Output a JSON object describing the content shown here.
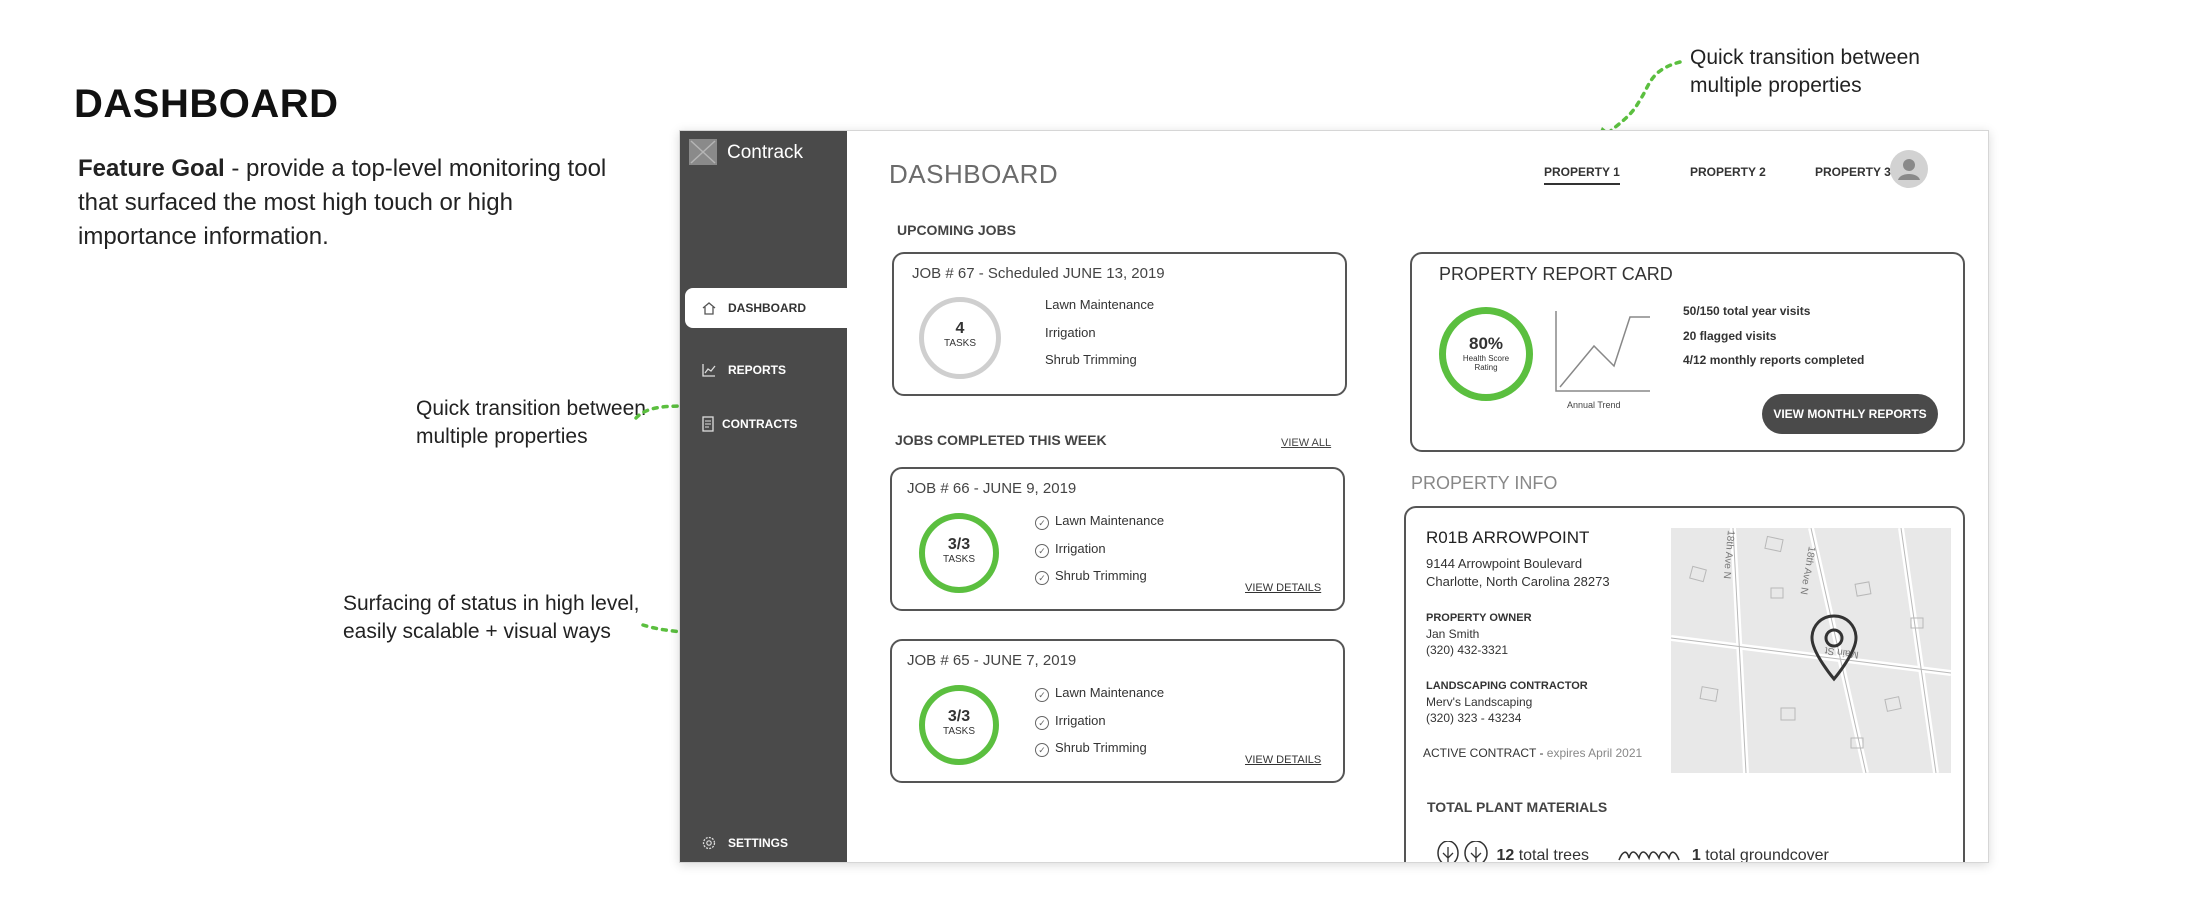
{
  "presentation": {
    "heading": "DASHBOARD",
    "feature_goal_label": "Feature Goal",
    "feature_goal_text": " - provide a top-level monitoring tool that surfaced the most high touch or high importance information.",
    "annotations": {
      "top_right": "Quick transition between multiple properties",
      "left_middle": "Quick transition between multiple properties",
      "left_lower": "Surfacing of status in high level, easily scalable + visual ways"
    },
    "accent_color": "#5bbf3f"
  },
  "app": {
    "brand": "Contrack",
    "sidebar": {
      "items": [
        {
          "label": "DASHBOARD",
          "icon": "home-icon",
          "active": true
        },
        {
          "label": "REPORTS",
          "icon": "chart-icon",
          "active": false
        },
        {
          "label": "CONTRACTS",
          "icon": "document-icon",
          "active": false
        }
      ],
      "settings_label": "SETTINGS"
    },
    "header": {
      "title": "DASHBOARD",
      "tabs": [
        "PROPERTY 1",
        "PROPERTY 2",
        "PROPERTY 3"
      ],
      "active_tab": "PROPERTY 1"
    },
    "upcoming": {
      "label": "UPCOMING JOBS",
      "job": {
        "title": "JOB # 67 -  Scheduled JUNE 13, 2019",
        "count": "4",
        "unit": "TASKS",
        "tasks": [
          "Lawn Maintenance",
          "Irrigation",
          "Shrub Trimming"
        ]
      }
    },
    "completed": {
      "label": "JOBS COMPLETED THIS WEEK",
      "view_all": "VIEW ALL",
      "jobs": [
        {
          "title": "JOB # 66 -  JUNE 9, 2019",
          "count": "3/3",
          "unit": "TASKS",
          "tasks": [
            "Lawn Maintenance",
            "Irrigation",
            "Shrub Trimming"
          ],
          "link": "VIEW DETAILS"
        },
        {
          "title": "JOB # 65 -  JUNE 7, 2019",
          "count": "3/3",
          "unit": "TASKS",
          "tasks": [
            "Lawn Maintenance",
            "Irrigation",
            "Shrub Trimming"
          ],
          "link": "VIEW DETAILS"
        }
      ]
    },
    "report_card": {
      "title": "PROPERTY REPORT CARD",
      "score": "80%",
      "score_label_1": "Health Score",
      "score_label_2": "Rating",
      "trend_label": "Annual Trend",
      "stats": [
        "50/150 total year visits",
        "20 flagged visits",
        "4/12 monthly reports completed"
      ],
      "button": "VIEW MONTHLY REPORTS"
    },
    "property_info": {
      "label": "PROPERTY INFO",
      "name": "R01B ARROWPOINT",
      "address_1": "9144 Arrowpoint Boulevard",
      "address_2": "Charlotte, North Carolina 28273",
      "owner_label": "PROPERTY OWNER",
      "owner_name": "Jan Smith",
      "owner_phone": "(320) 432-3321",
      "contractor_label": "LANDSCAPING CONTRACTOR",
      "contractor_name": "Merv's Landscaping",
      "contractor_phone": "(320) 323 - 43234",
      "contract_label": "ACTIVE CONTRACT -",
      "contract_expiry": " expires April 2021",
      "map_streets": [
        "18th Ave N",
        "18th Ave N",
        "Main St"
      ],
      "plants_label": "TOTAL PLANT MATERIALS",
      "trees_count": "12",
      "trees_label": "total trees",
      "ground_count": "1",
      "ground_label": "total groundcover"
    }
  }
}
